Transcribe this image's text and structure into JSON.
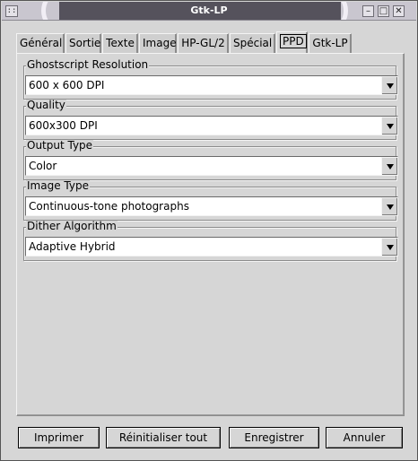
{
  "window": {
    "title": "Gtk-LP",
    "menu_icon": "window-menu-icon",
    "controls": [
      "minimize-icon",
      "maximize-icon",
      "close-icon"
    ]
  },
  "tabs": [
    {
      "label": "Général",
      "active": false
    },
    {
      "label": "Sortie",
      "active": false
    },
    {
      "label": "Texte",
      "active": false
    },
    {
      "label": "Image",
      "active": false
    },
    {
      "label": "HP-GL/2",
      "active": false
    },
    {
      "label": "Spécial",
      "active": false
    },
    {
      "label": "PPD",
      "active": true
    },
    {
      "label": "Gtk-LP",
      "active": false
    }
  ],
  "options": [
    {
      "label": "Ghostscript Resolution",
      "value": "600 x 600 DPI"
    },
    {
      "label": "Quality",
      "value": "600x300 DPI"
    },
    {
      "label": "Output Type",
      "value": "Color"
    },
    {
      "label": "Image Type",
      "value": "Continuous-tone photographs"
    },
    {
      "label": "Dither Algorithm",
      "value": "Adaptive Hybrid"
    }
  ],
  "buttons": {
    "print": "Imprimer",
    "reset": "Réinitialiser tout",
    "save": "Enregistrer",
    "cancel": "Annuler"
  }
}
